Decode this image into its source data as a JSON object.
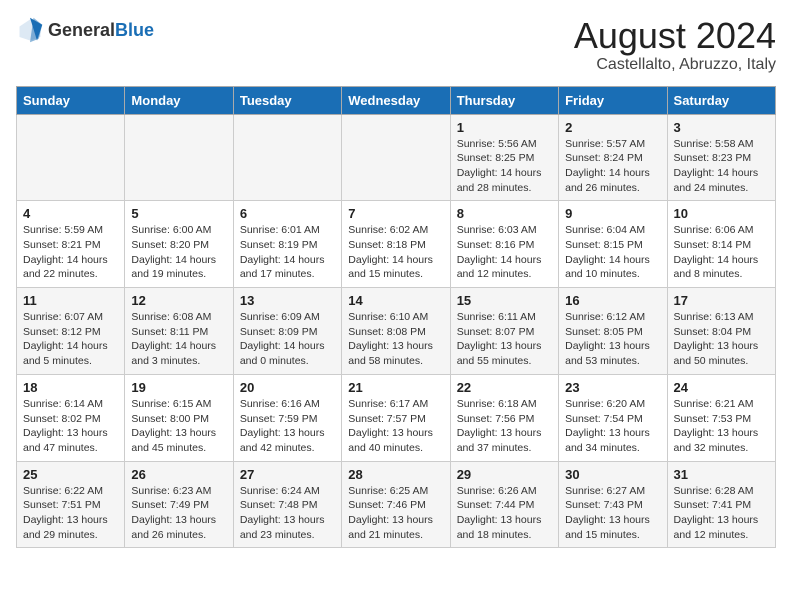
{
  "logo": {
    "text_general": "General",
    "text_blue": "Blue"
  },
  "title": "August 2024",
  "subtitle": "Castellalto, Abruzzo, Italy",
  "days_of_week": [
    "Sunday",
    "Monday",
    "Tuesday",
    "Wednesday",
    "Thursday",
    "Friday",
    "Saturday"
  ],
  "weeks": [
    [
      {
        "day": "",
        "info": ""
      },
      {
        "day": "",
        "info": ""
      },
      {
        "day": "",
        "info": ""
      },
      {
        "day": "",
        "info": ""
      },
      {
        "day": "1",
        "info": "Sunrise: 5:56 AM\nSunset: 8:25 PM\nDaylight: 14 hours and 28 minutes."
      },
      {
        "day": "2",
        "info": "Sunrise: 5:57 AM\nSunset: 8:24 PM\nDaylight: 14 hours and 26 minutes."
      },
      {
        "day": "3",
        "info": "Sunrise: 5:58 AM\nSunset: 8:23 PM\nDaylight: 14 hours and 24 minutes."
      }
    ],
    [
      {
        "day": "4",
        "info": "Sunrise: 5:59 AM\nSunset: 8:21 PM\nDaylight: 14 hours and 22 minutes."
      },
      {
        "day": "5",
        "info": "Sunrise: 6:00 AM\nSunset: 8:20 PM\nDaylight: 14 hours and 19 minutes."
      },
      {
        "day": "6",
        "info": "Sunrise: 6:01 AM\nSunset: 8:19 PM\nDaylight: 14 hours and 17 minutes."
      },
      {
        "day": "7",
        "info": "Sunrise: 6:02 AM\nSunset: 8:18 PM\nDaylight: 14 hours and 15 minutes."
      },
      {
        "day": "8",
        "info": "Sunrise: 6:03 AM\nSunset: 8:16 PM\nDaylight: 14 hours and 12 minutes."
      },
      {
        "day": "9",
        "info": "Sunrise: 6:04 AM\nSunset: 8:15 PM\nDaylight: 14 hours and 10 minutes."
      },
      {
        "day": "10",
        "info": "Sunrise: 6:06 AM\nSunset: 8:14 PM\nDaylight: 14 hours and 8 minutes."
      }
    ],
    [
      {
        "day": "11",
        "info": "Sunrise: 6:07 AM\nSunset: 8:12 PM\nDaylight: 14 hours and 5 minutes."
      },
      {
        "day": "12",
        "info": "Sunrise: 6:08 AM\nSunset: 8:11 PM\nDaylight: 14 hours and 3 minutes."
      },
      {
        "day": "13",
        "info": "Sunrise: 6:09 AM\nSunset: 8:09 PM\nDaylight: 14 hours and 0 minutes."
      },
      {
        "day": "14",
        "info": "Sunrise: 6:10 AM\nSunset: 8:08 PM\nDaylight: 13 hours and 58 minutes."
      },
      {
        "day": "15",
        "info": "Sunrise: 6:11 AM\nSunset: 8:07 PM\nDaylight: 13 hours and 55 minutes."
      },
      {
        "day": "16",
        "info": "Sunrise: 6:12 AM\nSunset: 8:05 PM\nDaylight: 13 hours and 53 minutes."
      },
      {
        "day": "17",
        "info": "Sunrise: 6:13 AM\nSunset: 8:04 PM\nDaylight: 13 hours and 50 minutes."
      }
    ],
    [
      {
        "day": "18",
        "info": "Sunrise: 6:14 AM\nSunset: 8:02 PM\nDaylight: 13 hours and 47 minutes."
      },
      {
        "day": "19",
        "info": "Sunrise: 6:15 AM\nSunset: 8:00 PM\nDaylight: 13 hours and 45 minutes."
      },
      {
        "day": "20",
        "info": "Sunrise: 6:16 AM\nSunset: 7:59 PM\nDaylight: 13 hours and 42 minutes."
      },
      {
        "day": "21",
        "info": "Sunrise: 6:17 AM\nSunset: 7:57 PM\nDaylight: 13 hours and 40 minutes."
      },
      {
        "day": "22",
        "info": "Sunrise: 6:18 AM\nSunset: 7:56 PM\nDaylight: 13 hours and 37 minutes."
      },
      {
        "day": "23",
        "info": "Sunrise: 6:20 AM\nSunset: 7:54 PM\nDaylight: 13 hours and 34 minutes."
      },
      {
        "day": "24",
        "info": "Sunrise: 6:21 AM\nSunset: 7:53 PM\nDaylight: 13 hours and 32 minutes."
      }
    ],
    [
      {
        "day": "25",
        "info": "Sunrise: 6:22 AM\nSunset: 7:51 PM\nDaylight: 13 hours and 29 minutes."
      },
      {
        "day": "26",
        "info": "Sunrise: 6:23 AM\nSunset: 7:49 PM\nDaylight: 13 hours and 26 minutes."
      },
      {
        "day": "27",
        "info": "Sunrise: 6:24 AM\nSunset: 7:48 PM\nDaylight: 13 hours and 23 minutes."
      },
      {
        "day": "28",
        "info": "Sunrise: 6:25 AM\nSunset: 7:46 PM\nDaylight: 13 hours and 21 minutes."
      },
      {
        "day": "29",
        "info": "Sunrise: 6:26 AM\nSunset: 7:44 PM\nDaylight: 13 hours and 18 minutes."
      },
      {
        "day": "30",
        "info": "Sunrise: 6:27 AM\nSunset: 7:43 PM\nDaylight: 13 hours and 15 minutes."
      },
      {
        "day": "31",
        "info": "Sunrise: 6:28 AM\nSunset: 7:41 PM\nDaylight: 13 hours and 12 minutes."
      }
    ]
  ]
}
